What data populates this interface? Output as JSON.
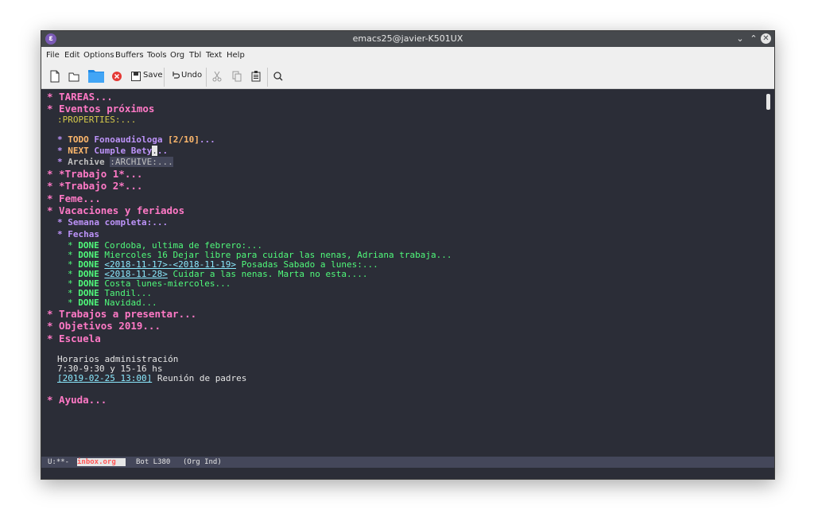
{
  "window": {
    "title": "emacs25@javier-K501UX"
  },
  "menubar": [
    "File",
    "Edit",
    "Options",
    "Buffers",
    "Tools",
    "Org",
    "Tbl",
    "Text",
    "Help"
  ],
  "toolbar": {
    "save_label": "Save",
    "undo_label": "Undo"
  },
  "editor": {
    "tareas": "* TAREAS...",
    "eventos": "* Eventos próximos",
    "properties": ":PROPERTIES:...",
    "fono_star": "* ",
    "fono_kw": "TODO",
    "fono_title": " Fonoaudiologa ",
    "fono_cookie": "[2/10]",
    "fono_rest": "...",
    "next_star": "* ",
    "next_kw": "NEXT",
    "next_title": " Cumple Bety",
    "next_cursor": ".",
    "next_rest": "..",
    "archive_star": "* ",
    "archive_title": "Archive ",
    "archive_tag": ":ARCHIVE:...",
    "trabajo1": "* *Trabajo 1*...",
    "trabajo2": "* *Trabajo 2*...",
    "feme": "* Feme...",
    "vacaciones": "* Vacaciones y feriados",
    "semana": "* Semana completa:...",
    "fechas": "* Fechas",
    "done_items": [
      {
        "pre": "* ",
        "kw": "DONE",
        "link": "",
        "text": " Cordoba, ultima de febrero:..."
      },
      {
        "pre": "* ",
        "kw": "DONE",
        "link": "",
        "text": " Miercoles 16 Dejar libre para cuidar las nenas, Adriana trabaja..."
      },
      {
        "pre": "* ",
        "kw": "DONE",
        "link": "<2018-11-17>-<2018-11-19>",
        "text": " Posadas Sabado a lunes:..."
      },
      {
        "pre": "* ",
        "kw": "DONE",
        "link": "<2018-11-28>",
        "text": " Cuidar a las nenas. Marta no esta...."
      },
      {
        "pre": "* ",
        "kw": "DONE",
        "link": "",
        "text": " Costa lunes-miercoles..."
      },
      {
        "pre": "* ",
        "kw": "DONE",
        "link": "",
        "text": " Tandil..."
      },
      {
        "pre": "* ",
        "kw": "DONE",
        "link": "",
        "text": " Navidad..."
      }
    ],
    "trabajos": "* Trabajos a presentar...",
    "objetivos": "* Objetivos 2019...",
    "escuela": "* Escuela",
    "horarios": "Horarios administración",
    "horario_line": "7:30-9:30 y 15-16 hs",
    "reunion_date": "[2019-02-25 13:00]",
    "reunion_text": " Reunión de padres",
    "ayuda": "* Ayuda..."
  },
  "modeline": {
    "state": "U:**-",
    "buffer": "inbox.org",
    "position": "Bot L380",
    "modes": "(Org Ind)"
  },
  "colors": {
    "background": "#2b2d37",
    "heading1": "#ff79c6",
    "heading2": "#bd93f9",
    "done": "#50fa7b",
    "todo": "#ffb86c",
    "link": "#8be9fd"
  }
}
